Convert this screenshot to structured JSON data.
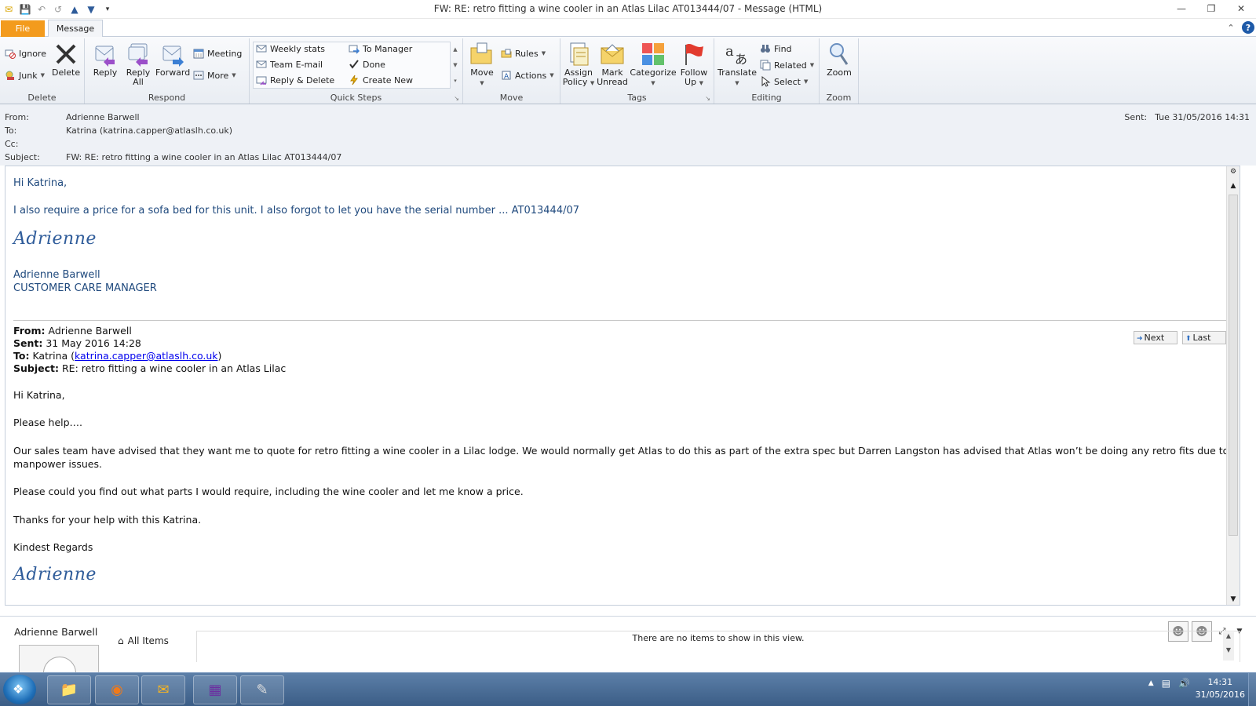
{
  "window": {
    "title": "FW: RE: retro fitting a wine cooler in an Atlas Lilac  AT013444/07  -  Message (HTML)",
    "minimize": "—",
    "maximize": "❐",
    "close": "✕"
  },
  "tabs": {
    "file": "File",
    "message": "Message",
    "collapse": "⌃",
    "help": "?"
  },
  "ribbon": {
    "groups": {
      "delete": "Delete",
      "respond": "Respond",
      "quick_steps": "Quick Steps",
      "move": "Move",
      "tags": "Tags",
      "editing": "Editing",
      "zoom": "Zoom"
    },
    "delete": {
      "ignore": "Ignore",
      "junk": "Junk",
      "delete": "Delete"
    },
    "respond": {
      "reply": "Reply",
      "reply_all_1": "Reply",
      "reply_all_2": "All",
      "forward": "Forward",
      "meeting": "Meeting",
      "more": "More"
    },
    "quick_steps": {
      "weekly_stats": "Weekly stats",
      "team_email": "Team E-mail",
      "reply_delete": "Reply & Delete",
      "to_manager": "To Manager",
      "done": "Done",
      "create_new": "Create New"
    },
    "move": {
      "move": "Move",
      "rules": "Rules",
      "actions": "Actions"
    },
    "tags": {
      "assign_1": "Assign",
      "assign_2": "Policy",
      "mark_1": "Mark",
      "mark_2": "Unread",
      "categorize": "Categorize",
      "follow_1": "Follow",
      "follow_2": "Up"
    },
    "editing": {
      "translate": "Translate",
      "find": "Find",
      "related": "Related",
      "select": "Select"
    },
    "zoom": {
      "zoom": "Zoom"
    }
  },
  "header": {
    "from_label": "From:",
    "from": "Adrienne Barwell",
    "to_label": "To:",
    "to": "Katrina (katrina.capper@atlaslh.co.uk)",
    "cc_label": "Cc:",
    "cc": "",
    "subject_label": "Subject:",
    "subject": "FW: RE: retro fitting a wine cooler in an Atlas Lilac  AT013444/07",
    "sent_label": "Sent:",
    "sent": "Tue 31/05/2016 14:31"
  },
  "body": {
    "greeting": "Hi Katrina,",
    "line1": "I also require a price for a sofa bed for this unit.  I also forgot to let you have the serial number  ... AT013444/07",
    "signature": "Adrienne",
    "sig_name": "Adrienne Barwell",
    "sig_title": "CUSTOMER CARE MANAGER",
    "next": "Next",
    "last": "Last",
    "fwd": {
      "from_label": "From:",
      "from": "Adrienne Barwell",
      "sent_label": "Sent:",
      "sent": "31 May 2016 14:28",
      "to_label": "To:",
      "to_pre": "Katrina (",
      "to_email": "katrina.capper@atlaslh.co.uk",
      "to_post": ")",
      "subject_label": "Subject:",
      "subject": "RE: retro fitting a wine cooler in an Atlas Lilac"
    },
    "p_greet": "Hi Katrina,",
    "p_help": "Please help….",
    "p_main1": "Our sales team have advised that they want me to quote for retro fitting a wine cooler in a Lilac lodge.  We would normally get Atlas to do this as part of the extra spec but Darren Langston has advised that Atlas won’t be doing any retro fits due to",
    "p_main2": "manpower issues.",
    "p_please": "Please could you find out what parts I would require, including the wine cooler and let me know a price.",
    "p_thanks": "Thanks for your help with this Katrina.",
    "p_regards": "Kindest Regards",
    "signature2": "Adrienne"
  },
  "people": {
    "name": "Adrienne Barwell",
    "all_items": "All Items",
    "no_items": "There are no items to show in this view."
  },
  "taskbar": {
    "time": "14:31",
    "date": "31/05/2016"
  },
  "colors": {
    "accent_file_tab": "#f39b1d",
    "body_blue_text": "#1f497d",
    "taskbar": "#3b5d86"
  }
}
